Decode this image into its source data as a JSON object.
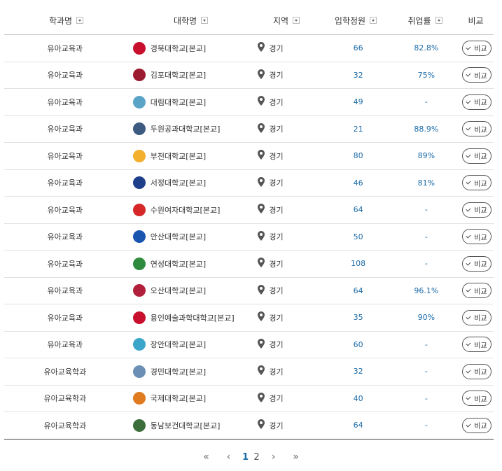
{
  "header": {
    "dept": "학과명",
    "univ": "대학명",
    "region": "지역",
    "quota": "입학정원",
    "employment": "취업률",
    "compare": "비교"
  },
  "rows": [
    {
      "dept": "유아교육과",
      "univ": "경북대학교[본교]",
      "region": "경기",
      "quota": "66",
      "emp": "82.8%",
      "logo_color": "#c8102e",
      "compare": "비교"
    },
    {
      "dept": "유아교육과",
      "univ": "김포대학교[본교]",
      "region": "경기",
      "quota": "32",
      "emp": "75%",
      "logo_color": "#9b1b30",
      "compare": "비교"
    },
    {
      "dept": "유아교육과",
      "univ": "대림대학교[본교]",
      "region": "경기",
      "quota": "49",
      "emp": "-",
      "logo_color": "#5aa4c8",
      "compare": "비교"
    },
    {
      "dept": "유아교육과",
      "univ": "두원공과대학교[본교]",
      "region": "경기",
      "quota": "21",
      "emp": "88.9%",
      "logo_color": "#3d5a80",
      "compare": "비교"
    },
    {
      "dept": "유아교육과",
      "univ": "부천대학교[본교]",
      "region": "경기",
      "quota": "80",
      "emp": "89%",
      "logo_color": "#f2b02e",
      "compare": "비교"
    },
    {
      "dept": "유아교육과",
      "univ": "서정대학교[본교]",
      "region": "경기",
      "quota": "46",
      "emp": "81%",
      "logo_color": "#1f3f8a",
      "compare": "비교"
    },
    {
      "dept": "유아교육과",
      "univ": "수원여자대학교[본교]",
      "region": "경기",
      "quota": "64",
      "emp": "-",
      "logo_color": "#d62828",
      "compare": "비교"
    },
    {
      "dept": "유아교육과",
      "univ": "안산대학교[본교]",
      "region": "경기",
      "quota": "50",
      "emp": "-",
      "logo_color": "#1a56b0",
      "compare": "비교"
    },
    {
      "dept": "유아교육과",
      "univ": "연성대학교[본교]",
      "region": "경기",
      "quota": "108",
      "emp": "-",
      "logo_color": "#2e8b3e",
      "compare": "비교"
    },
    {
      "dept": "유아교육과",
      "univ": "오산대학교[본교]",
      "region": "경기",
      "quota": "64",
      "emp": "96.1%",
      "logo_color": "#b0203a",
      "compare": "비교"
    },
    {
      "dept": "유아교육과",
      "univ": "용인예술과학대학교[본교]",
      "region": "경기",
      "quota": "35",
      "emp": "90%",
      "logo_color": "#c8102e",
      "compare": "비교"
    },
    {
      "dept": "유아교육과",
      "univ": "장안대학교[본교]",
      "region": "경기",
      "quota": "60",
      "emp": "-",
      "logo_color": "#3ba6c9",
      "compare": "비교"
    },
    {
      "dept": "유아교육학과",
      "univ": "경민대학교[본교]",
      "region": "경기",
      "quota": "32",
      "emp": "-",
      "logo_color": "#6b8fb5",
      "compare": "비교"
    },
    {
      "dept": "유아교육학과",
      "univ": "국제대학교[본교]",
      "region": "경기",
      "quota": "40",
      "emp": "-",
      "logo_color": "#e07a1f",
      "compare": "비교"
    },
    {
      "dept": "유아교육학과",
      "univ": "동남보건대학교[본교]",
      "region": "경기",
      "quota": "64",
      "emp": "-",
      "logo_color": "#3b6e3b",
      "compare": "비교"
    }
  ],
  "pagination": {
    "first": "«",
    "prev": "‹",
    "pages": [
      "1",
      "2"
    ],
    "current": "1",
    "next": "›",
    "last": "»"
  },
  "colors": {
    "accent": "#1a6aa7",
    "border": "#e2e2e2"
  }
}
